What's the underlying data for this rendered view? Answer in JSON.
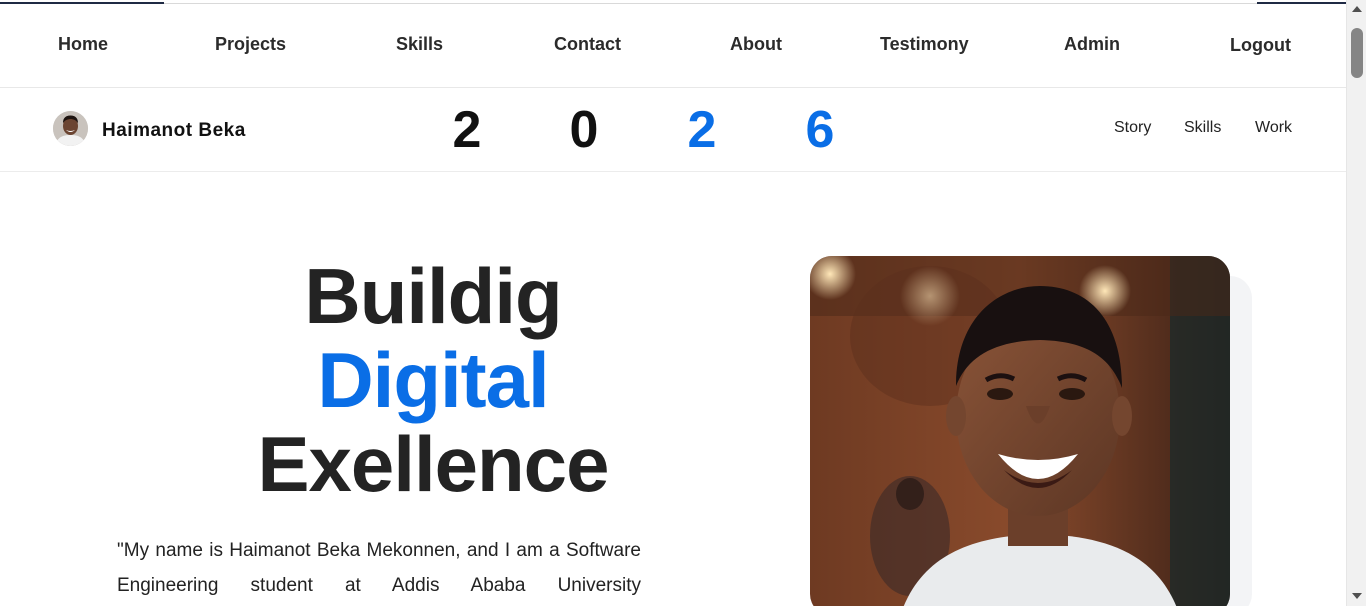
{
  "nav": {
    "items": [
      {
        "label": "Home"
      },
      {
        "label": "Projects"
      },
      {
        "label": "Skills"
      },
      {
        "label": "Contact"
      },
      {
        "label": "About"
      },
      {
        "label": "Testimony"
      },
      {
        "label": "Admin"
      },
      {
        "label": "Logout"
      }
    ]
  },
  "brand": {
    "name": "Haimanot Beka",
    "avatar_icon": "profile-photo"
  },
  "year": {
    "digits": [
      "2",
      "0",
      "2",
      "6"
    ],
    "colors": {
      "dark": "#111111",
      "accent": "#0a6ee6"
    }
  },
  "subnav": {
    "items": [
      {
        "label": "Story"
      },
      {
        "label": "Skills"
      },
      {
        "label": "Work"
      }
    ]
  },
  "hero": {
    "title_line1": "Buildig",
    "title_line2": "Digital",
    "title_line3": "Exellence",
    "intro": "\"My name is Haimanot Beka Mekonnen, and I am a Software Engineering student at Addis Ababa University",
    "accent_color": "#0a6ee6"
  }
}
